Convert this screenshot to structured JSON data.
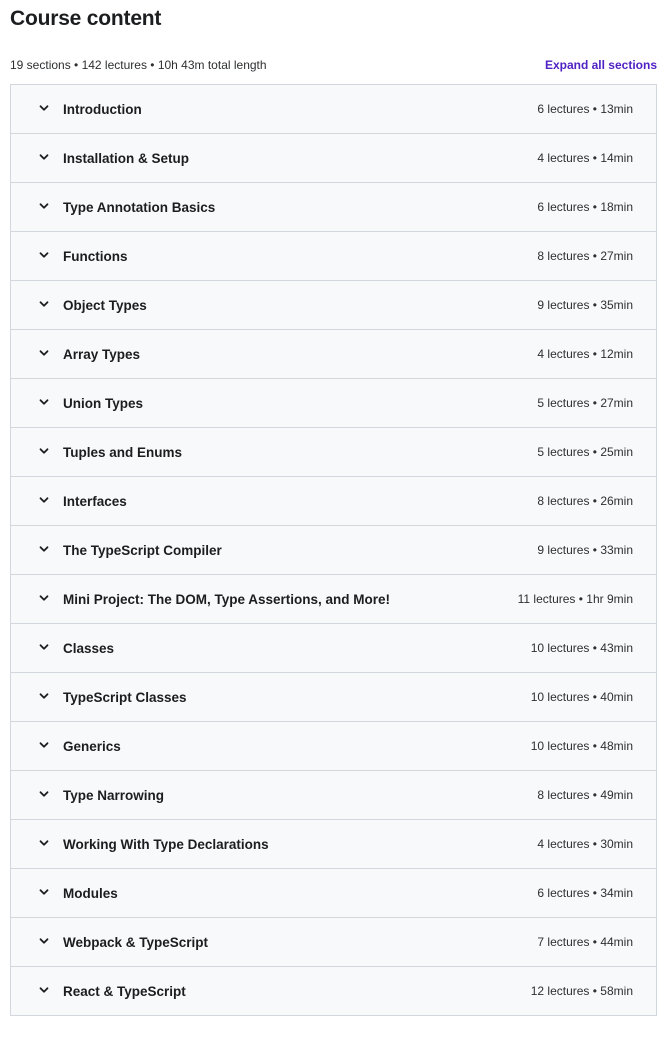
{
  "header": {
    "title": "Course content",
    "summary": "19 sections • 142 lectures • 10h 43m total length",
    "expand_label": "Expand all sections"
  },
  "icons": {
    "section_toggle": "chevron-down-icon"
  },
  "colors": {
    "accent": "#5022c3",
    "section_bg": "#f7f9fa",
    "border": "#d1d7dc"
  },
  "sections": [
    {
      "title": "Introduction",
      "meta": "6 lectures • 13min"
    },
    {
      "title": "Installation & Setup",
      "meta": "4 lectures • 14min"
    },
    {
      "title": "Type Annotation Basics",
      "meta": "6 lectures • 18min"
    },
    {
      "title": "Functions",
      "meta": "8 lectures • 27min"
    },
    {
      "title": "Object Types",
      "meta": "9 lectures • 35min"
    },
    {
      "title": "Array Types",
      "meta": "4 lectures • 12min"
    },
    {
      "title": "Union Types",
      "meta": "5 lectures • 27min"
    },
    {
      "title": "Tuples and Enums",
      "meta": "5 lectures • 25min"
    },
    {
      "title": "Interfaces",
      "meta": "8 lectures • 26min"
    },
    {
      "title": "The TypeScript Compiler",
      "meta": "9 lectures • 33min"
    },
    {
      "title": "Mini Project: The DOM, Type Assertions, and More!",
      "meta": "11 lectures • 1hr 9min"
    },
    {
      "title": "Classes",
      "meta": "10 lectures • 43min"
    },
    {
      "title": "TypeScript Classes",
      "meta": "10 lectures • 40min"
    },
    {
      "title": "Generics",
      "meta": "10 lectures • 48min"
    },
    {
      "title": "Type Narrowing",
      "meta": "8 lectures • 49min"
    },
    {
      "title": "Working With Type Declarations",
      "meta": "4 lectures • 30min"
    },
    {
      "title": "Modules",
      "meta": "6 lectures • 34min"
    },
    {
      "title": "Webpack & TypeScript",
      "meta": "7 lectures • 44min"
    },
    {
      "title": "React & TypeScript",
      "meta": "12 lectures • 58min"
    }
  ]
}
